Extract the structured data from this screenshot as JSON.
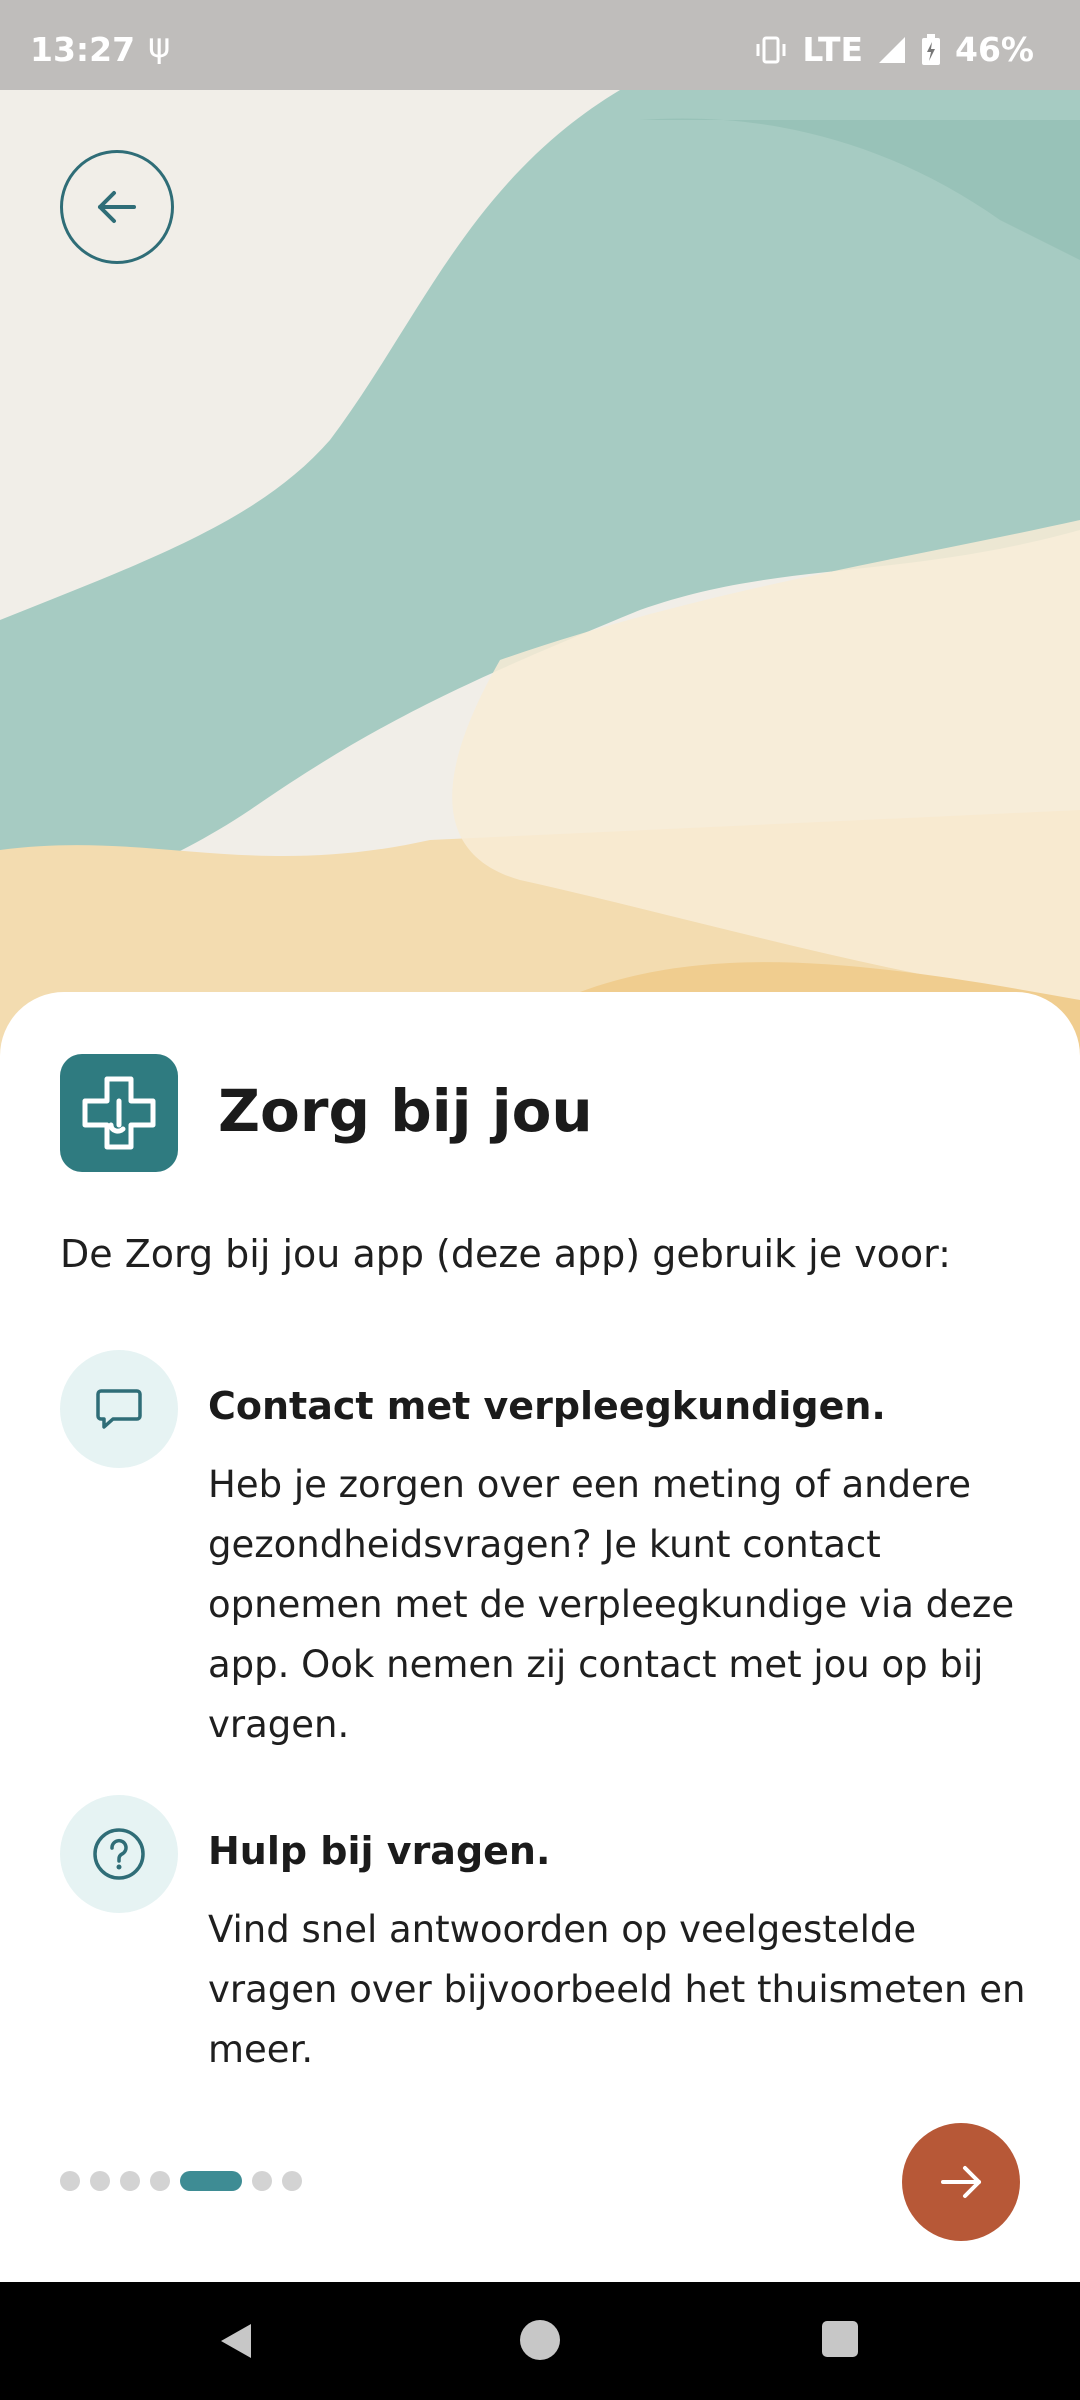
{
  "status_bar": {
    "time": "13:27",
    "network": "LTE",
    "battery": "46%"
  },
  "header": {
    "back_icon": "arrow-left-icon"
  },
  "app": {
    "title": "Zorg bij jou",
    "icon": "medical-cross-icon"
  },
  "intro": "De Zorg bij jou app (deze app) gebruik je voor:",
  "features": [
    {
      "icon": "chat-bubble-icon",
      "title": "Contact met verpleegkundigen.",
      "text": "Heb je zorgen over een meting of andere gezondheidsvragen? Je kunt contact opnemen met de verpleegkundige via deze app. Ook nemen zij contact met jou op bij vragen."
    },
    {
      "icon": "question-circle-icon",
      "title": "Hulp bij vragen.",
      "text": "Vind snel antwoorden op veelgestelde vragen over bijvoorbeeld het thuismeten en meer."
    }
  ],
  "pagination": {
    "total": 7,
    "current": 5
  },
  "next_icon": "arrow-right-icon",
  "colors": {
    "accent": "#2f7b80",
    "next_button": "#b75837",
    "teal_wave": "#9cc5bb",
    "sand_wave": "#f3d9a6"
  }
}
